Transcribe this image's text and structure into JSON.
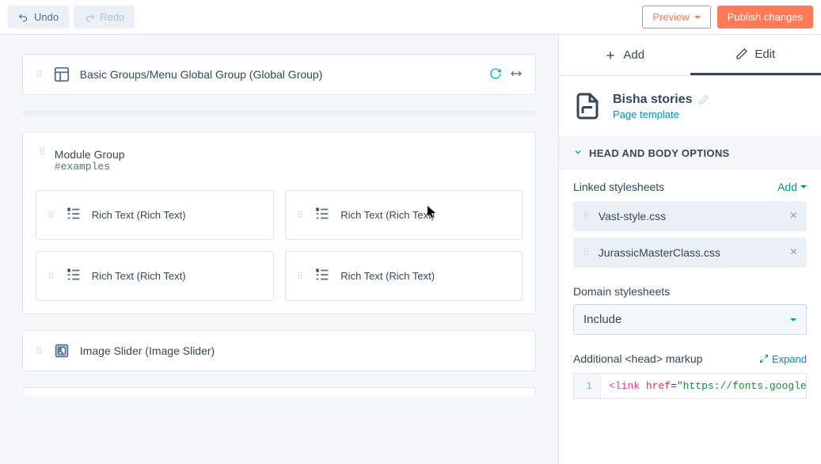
{
  "topbar": {
    "undo": "Undo",
    "redo": "Redo",
    "preview": "Preview",
    "publish": "Publish changes"
  },
  "modules": {
    "globalGroup": "Basic Groups/Menu Global Group (Global Group)",
    "moduleGroupTitle": "Module Group",
    "moduleGroupId": "#examples",
    "richText": "Rich Text (Rich Text)",
    "imageSlider": "Image Slider (Image Slider)"
  },
  "sidebar": {
    "tabs": {
      "add": "Add",
      "edit": "Edit"
    },
    "template": {
      "name": "Bisha stories",
      "type": "Page template"
    },
    "accordion": "HEAD AND BODY OPTIONS",
    "linkedStylesheets": {
      "label": "Linked stylesheets",
      "addLabel": "Add",
      "items": [
        "Vast-style.css",
        "JurassicMasterClass.css"
      ]
    },
    "domainStylesheets": {
      "label": "Domain stylesheets",
      "value": "Include"
    },
    "headMarkup": {
      "label": "Additional <head> markup",
      "expand": "Expand",
      "lineNo": "1",
      "tag": "<link",
      "attr": "href",
      "eq": "=",
      "str": "\"https://fonts.googleapi"
    }
  }
}
